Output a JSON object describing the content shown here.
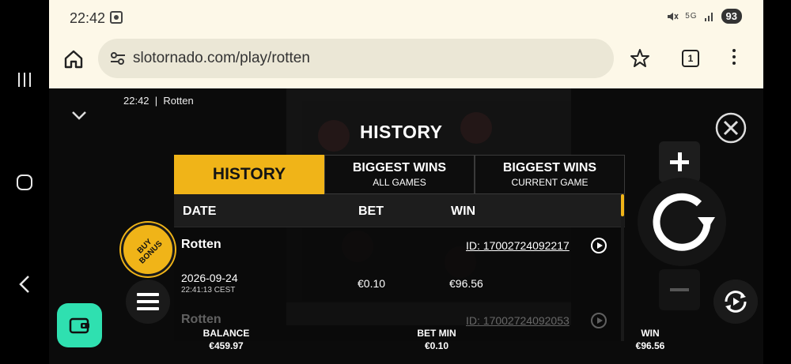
{
  "status": {
    "time": "22:42",
    "battery": "93",
    "network": "5G"
  },
  "browser": {
    "url": "slotornado.com/play/rotten",
    "tab_count": "1"
  },
  "game": {
    "time": "22:42",
    "title_separator": "|",
    "name": "Rotten",
    "history_title": "HISTORY"
  },
  "tabs": [
    {
      "main": "HISTORY",
      "sub": ""
    },
    {
      "main": "BIGGEST WINS",
      "sub": "ALL GAMES"
    },
    {
      "main": "BIGGEST WINS",
      "sub": "CURRENT GAME"
    }
  ],
  "columns": {
    "date": "DATE",
    "bet": "BET",
    "win": "WIN"
  },
  "rows": [
    {
      "game": "Rotten",
      "id": "ID: 17002724092217",
      "date": "2026-09-24",
      "time": "22:41:13 CEST",
      "bet": "€0.10",
      "win": "€96.56"
    },
    {
      "game": "Rotten",
      "id": "ID: 17002724092053",
      "date": "",
      "time": "",
      "bet": "",
      "win": ""
    }
  ],
  "buy_bonus": "BUY BONUS",
  "info": {
    "balance_label": "BALANCE",
    "balance_value": "€459.97",
    "bet_label": "BET MIN",
    "bet_value": "€0.10",
    "win_label": "WIN",
    "win_value": "€96.56"
  },
  "colors": {
    "accent": "#f0b418",
    "wallet": "#2fe0b0",
    "browser_bg": "#fdf8e8"
  },
  "icons": [
    "recents-icon",
    "home-nav-icon",
    "back-icon",
    "home-icon",
    "tune-icon",
    "star-icon",
    "tabs-icon",
    "more-icon",
    "chevron-down-icon",
    "close-icon",
    "plus-icon",
    "spin-icon",
    "minus-icon",
    "autoplay-icon",
    "menu-icon",
    "play-icon",
    "wallet-icon"
  ]
}
